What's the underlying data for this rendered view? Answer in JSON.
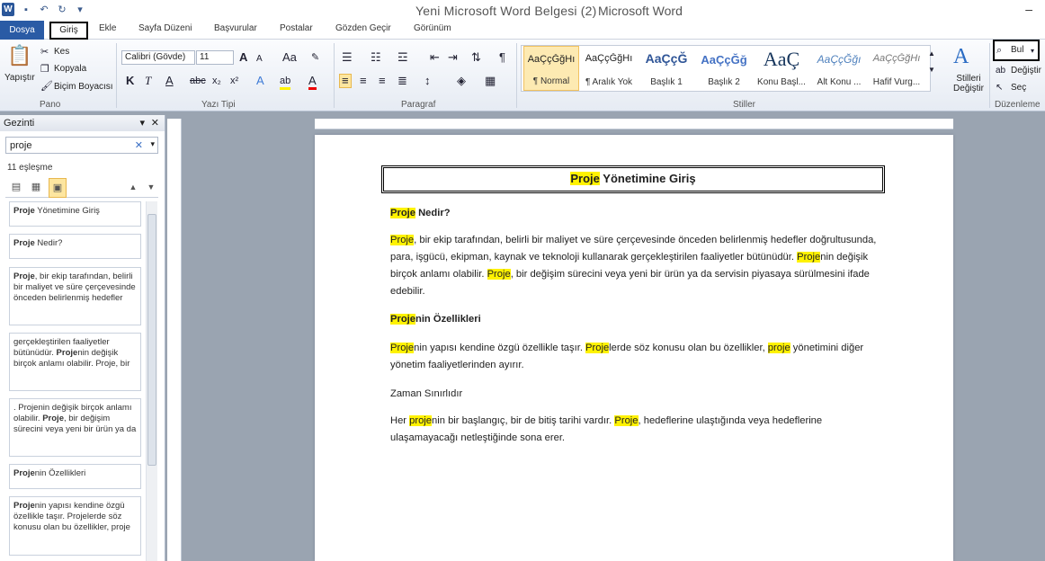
{
  "titlebar": {
    "doc_title": "Yeni Microsoft Word Belgesi (2)",
    "app": "Microsoft Word"
  },
  "tabs": {
    "file": "Dosya",
    "home": "Giriş",
    "insert": "Ekle",
    "layout": "Sayfa Düzeni",
    "references": "Başvurular",
    "mailings": "Postalar",
    "review": "Gözden Geçir",
    "view": "Görünüm"
  },
  "clipboard": {
    "paste": "Yapıştır",
    "cut": "Kes",
    "copy": "Kopyala",
    "format_painter": "Biçim Boyacısı",
    "label": "Pano"
  },
  "font": {
    "name": "Calibri (Gövde)",
    "size": "11",
    "label": "Yazı Tipi"
  },
  "paragraph": {
    "label": "Paragraf"
  },
  "styles": {
    "label": "Stiller",
    "change": "Stilleri Değiştir",
    "items": [
      {
        "sample": "AaÇçĞğHı",
        "name": "¶ Normal"
      },
      {
        "sample": "AaÇçĞğHı",
        "name": "¶ Aralık Yok"
      },
      {
        "sample": "AaÇçĞ",
        "name": "Başlık 1"
      },
      {
        "sample": "AaÇçĞğ",
        "name": "Başlık 2"
      },
      {
        "sample": "AaÇ",
        "name": "Konu Başl..."
      },
      {
        "sample": "AaÇçĞğı",
        "name": "Alt Konu ..."
      },
      {
        "sample": "AaÇçĞğHı",
        "name": "Hafif Vurg..."
      }
    ]
  },
  "editing": {
    "find": "Bul",
    "replace": "Değiştir",
    "select": "Seç",
    "label": "Düzenleme"
  },
  "nav": {
    "title": "Gezinti",
    "search_value": "proje",
    "count": "11 eşleşme",
    "results": [
      {
        "pre": "",
        "hit": "Proje",
        "post": " Yönetimine Giriş"
      },
      {
        "pre": "",
        "hit": "Proje",
        "post": " Nedir?"
      },
      {
        "pre": "",
        "hit": "Proje",
        "post": ", bir ekip tarafından, belirli bir maliyet ve süre çerçevesinde önceden belirlenmiş hedefler"
      },
      {
        "pre": "gerçekleştirilen faaliyetler bütünüdür. ",
        "hit": "Proje",
        "post": "nin değişik birçok anlamı olabilir. Proje, bir"
      },
      {
        "pre": ". Projenin değişik birçok anlamı olabilir. ",
        "hit": "Proje",
        "post": ", bir değişim sürecini veya yeni bir ürün ya da"
      },
      {
        "pre": "",
        "hit": "Proje",
        "post": "nin Özellikleri"
      },
      {
        "pre": "",
        "hit": "Proje",
        "post": "nin yapısı kendine özgü özellikle taşır. Projelerde söz konusu olan bu özellikler, proje"
      }
    ]
  },
  "document": {
    "heading_hit": "Proje",
    "heading_rest": " Yönetimine Giriş",
    "h1_hit": "Proje",
    "h1_rest": " Nedir?",
    "p1_a_hit": "Proje",
    "p1_a": ", bir ekip tarafından, belirli bir maliyet ve süre çerçevesinde önceden belirlenmiş hedefler doğrultusunda, para, işgücü, ekipman, kaynak ve teknoloji kullanarak gerçekleştirilen faaliyetler bütünüdür. ",
    "p1_b_hit": "Proje",
    "p1_b": "nin değişik birçok anlamı olabilir. ",
    "p1_c_hit": "Proje",
    "p1_c": ", bir değişim sürecini veya yeni bir ürün ya da servisin piyasaya sürülmesini ifade edebilir.",
    "h2_hit": "Proje",
    "h2_rest": "nin Özellikleri",
    "p2_a_hit": "Proje",
    "p2_a": "nin yapısı kendine özgü özellikle taşır. ",
    "p2_b_hit": "Proje",
    "p2_b": "lerde söz konusu olan bu özellikler, ",
    "p2_c_hit": "proje",
    "p2_c": " yönetimini diğer yönetim faaliyetlerinden ayırır.",
    "h3": "Zaman Sınırlıdır",
    "p3_pre": "Her ",
    "p3_a_hit": "proje",
    "p3_a": "nin bir başlangıç, bir de bitiş tarihi vardır. ",
    "p3_b_hit": "Proje",
    "p3_b": ", hedeflerine ulaştığında veya hedeflerine ulaşamayacağı netleştiğinde sona erer."
  }
}
